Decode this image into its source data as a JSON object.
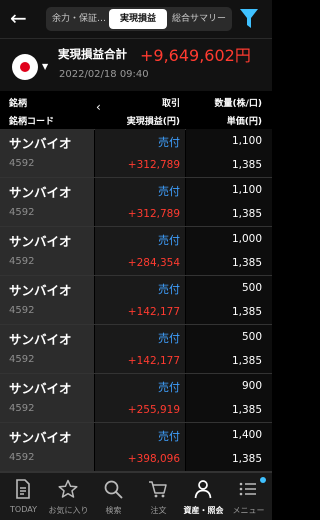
{
  "header": {
    "tabs": [
      {
        "label": "余力・保証…"
      },
      {
        "label": "実現損益"
      },
      {
        "label": "総合サマリー"
      }
    ]
  },
  "summary": {
    "label": "実現損益合計",
    "value": "+9,649,602円",
    "date": "2022/02/18 09:40"
  },
  "columns": {
    "name": "銘柄",
    "code": "銘柄コード",
    "trade": "取引",
    "pl": "実現損益(円)",
    "qty": "数量(株/口)",
    "price": "単価(円)"
  },
  "rows": [
    {
      "name": "サンバイオ",
      "code": "4592",
      "side": "売付",
      "pl": "+312,789",
      "qty": "1,100",
      "price": "1,385"
    },
    {
      "name": "サンバイオ",
      "code": "4592",
      "side": "売付",
      "pl": "+312,789",
      "qty": "1,100",
      "price": "1,385"
    },
    {
      "name": "サンバイオ",
      "code": "4592",
      "side": "売付",
      "pl": "+284,354",
      "qty": "1,000",
      "price": "1,385"
    },
    {
      "name": "サンバイオ",
      "code": "4592",
      "side": "売付",
      "pl": "+142,177",
      "qty": "500",
      "price": "1,385"
    },
    {
      "name": "サンバイオ",
      "code": "4592",
      "side": "売付",
      "pl": "+142,177",
      "qty": "500",
      "price": "1,385"
    },
    {
      "name": "サンバイオ",
      "code": "4592",
      "side": "売付",
      "pl": "+255,919",
      "qty": "900",
      "price": "1,385"
    },
    {
      "name": "サンバイオ",
      "code": "4592",
      "side": "売付",
      "pl": "+398,096",
      "qty": "1,400",
      "price": "1,385"
    }
  ],
  "nav": [
    {
      "label": "TODAY",
      "icon": "document-icon"
    },
    {
      "label": "お気に入り",
      "icon": "star-icon"
    },
    {
      "label": "検索",
      "icon": "search-icon"
    },
    {
      "label": "注文",
      "icon": "cart-icon"
    },
    {
      "label": "資産・照会",
      "icon": "person-icon"
    },
    {
      "label": "メニュー",
      "icon": "menu-icon"
    }
  ],
  "colors": {
    "profit": "#ff3b30",
    "sell": "#3fa0ff",
    "accent": "#3fc1ff"
  }
}
